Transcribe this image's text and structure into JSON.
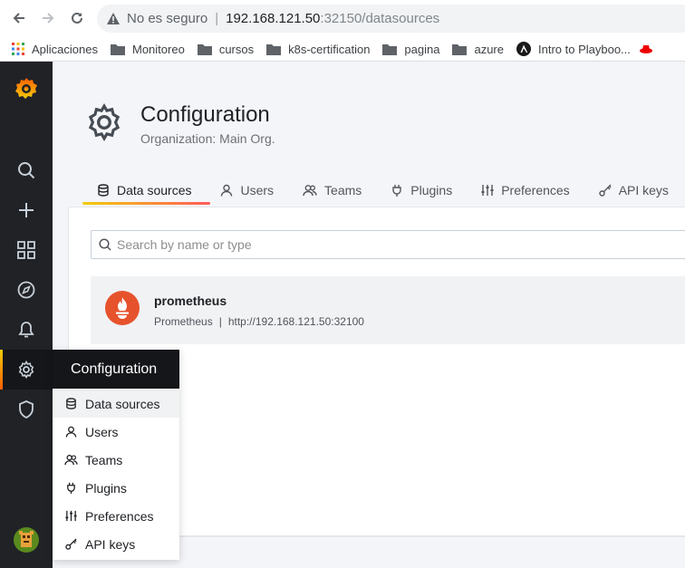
{
  "browser": {
    "insecure_label": "No es seguro",
    "url_host": "192.168.121.50",
    "url_rest": ":32150/datasources"
  },
  "bookmarks": [
    {
      "label": "Aplicaciones",
      "icon": "apps-grid-icon"
    },
    {
      "label": "Monitoreo",
      "icon": "folder-icon"
    },
    {
      "label": "cursos",
      "icon": "folder-icon"
    },
    {
      "label": "k8s-certification",
      "icon": "folder-icon"
    },
    {
      "label": "pagina",
      "icon": "folder-icon"
    },
    {
      "label": "azure",
      "icon": "folder-icon"
    },
    {
      "label": "Intro to Playboo...",
      "icon": "ansible-icon"
    }
  ],
  "page": {
    "title": "Configuration",
    "subtitle": "Organization: Main Org."
  },
  "tabs": [
    {
      "label": "Data sources",
      "icon": "database-icon",
      "active": true
    },
    {
      "label": "Users",
      "icon": "user-icon"
    },
    {
      "label": "Teams",
      "icon": "users-icon"
    },
    {
      "label": "Plugins",
      "icon": "plug-icon"
    },
    {
      "label": "Preferences",
      "icon": "sliders-icon"
    },
    {
      "label": "API keys",
      "icon": "key-icon"
    }
  ],
  "search": {
    "placeholder": "Search by name or type"
  },
  "datasource": {
    "name": "prometheus",
    "type": "Prometheus",
    "separator": "|",
    "url": "http://192.168.121.50:32100"
  },
  "menu": {
    "header": "Configuration",
    "items": [
      {
        "label": "Data sources",
        "icon": "database-icon"
      },
      {
        "label": "Users",
        "icon": "user-icon"
      },
      {
        "label": "Teams",
        "icon": "users-icon"
      },
      {
        "label": "Plugins",
        "icon": "plug-icon"
      },
      {
        "label": "Preferences",
        "icon": "sliders-icon"
      },
      {
        "label": "API keys",
        "icon": "key-icon"
      }
    ]
  },
  "colors": {
    "sidebar": "#202226",
    "accent_start": "#f2cc0c",
    "accent_end": "#ff5f00",
    "prometheus": "#e6522c"
  }
}
